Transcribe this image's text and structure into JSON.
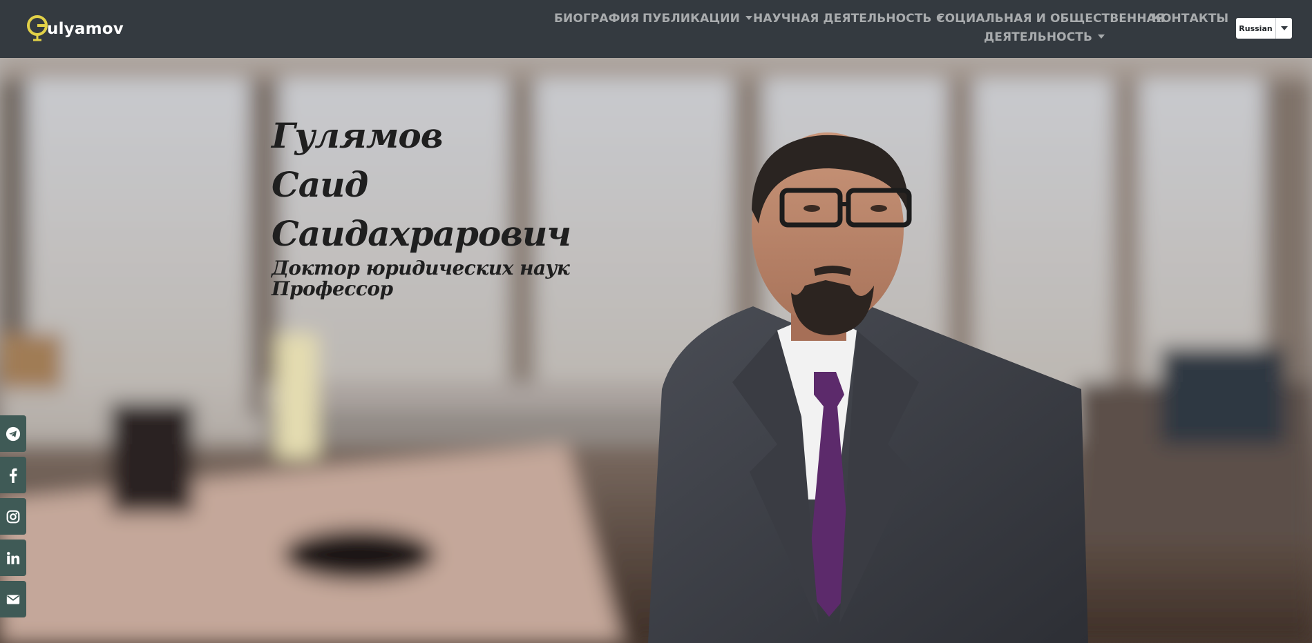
{
  "brand": {
    "name": "Gulyamov",
    "text_after_mark": "ulyamov",
    "accent_color": "#e2d148"
  },
  "nav": {
    "items": [
      {
        "label": "БИОГРАФИЯ"
      },
      {
        "label": "ПУБЛИКАЦИИ",
        "dropdown": true
      },
      {
        "label": "НАУЧНАЯ ДЕЯТЕЛЬНОСТЬ",
        "dropdown": true
      },
      {
        "label_line1": "СОЦИАЛЬНАЯ И ОБЩЕСТВЕННАЯ",
        "label_line2": "ДЕЯТЕЛЬНОСТЬ",
        "dropdown": true
      },
      {
        "label": "КОНТАКТЫ"
      }
    ],
    "color": "#a8abad",
    "background": "#343a40"
  },
  "language": {
    "selected": "Russian"
  },
  "hero": {
    "name_lines": [
      "Гулямов",
      "Саид",
      "Саидахрарович"
    ],
    "subtitle_lines": [
      "Доктор юридических наук",
      "Профессор"
    ],
    "text_color": "#1f1f1f"
  },
  "social": [
    {
      "icon": "telegram-icon"
    },
    {
      "icon": "facebook-icon"
    },
    {
      "icon": "instagram-icon"
    },
    {
      "icon": "linkedin-icon"
    },
    {
      "icon": "email-icon"
    }
  ],
  "colors": {
    "social_button": "#3f5a56"
  }
}
